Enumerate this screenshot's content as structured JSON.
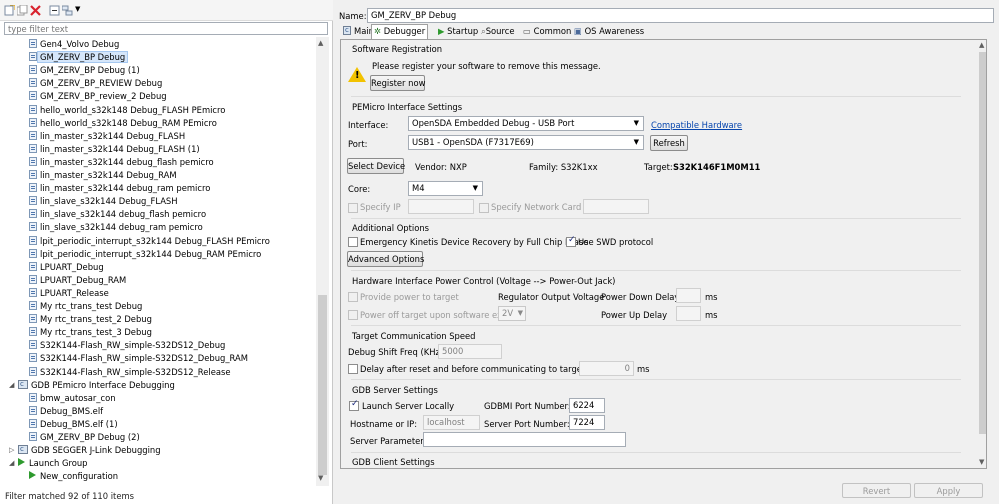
{
  "filter": {
    "placeholder": "type filter text"
  },
  "tree": {
    "items": [
      "Gen4_Volvo Debug",
      "GM_ZERV_BP Debug",
      "GM_ZERV_BP Debug (1)",
      "GM_ZERV_BP_REVIEW Debug",
      "GM_ZERV_BP_review_2 Debug",
      "hello_world_s32k148 Debug_FLASH PEmicro",
      "hello_world_s32k148 Debug_RAM PEmicro",
      "lin_master_s32k144 Debug_FLASH",
      "lin_master_s32k144 Debug_FLASH (1)",
      "lin_master_s32k144 debug_flash pemicro",
      "lin_master_s32k144 Debug_RAM",
      "lin_master_s32k144 debug_ram pemicro",
      "lin_slave_s32k144 Debug_FLASH",
      "lin_slave_s32k144 debug_flash pemicro",
      "lin_slave_s32k144 debug_ram pemicro",
      "lpit_periodic_interrupt_s32k144 Debug_FLASH PEmicro",
      "lpit_periodic_interrupt_s32k144 Debug_RAM PEmicro",
      "LPUART_Debug",
      "LPUART_Debug_RAM",
      "LPUART_Release",
      "My rtc_trans_test Debug",
      "My rtc_trans_test_2 Debug",
      "My rtc_trans_test_3 Debug",
      "S32K144-Flash_RW_simple-S32DS12_Debug",
      "S32K144-Flash_RW_simple-S32DS12_Debug_RAM",
      "S32K144-Flash_RW_simple-S32DS12_Release"
    ],
    "pemicro_group": "GDB PEmicro Interface Debugging",
    "pemicro_items": [
      "bmw_autosar_con",
      "Debug_BMS.elf",
      "Debug_BMS.elf (1)",
      "GM_ZERV_BP Debug (2)"
    ],
    "segger_group": "GDB SEGGER J-Link Debugging",
    "launch_group": "Launch Group",
    "launch_items": [
      "New_configuration"
    ]
  },
  "status": "Filter matched 92 of 110 items",
  "name": {
    "label": "Name:",
    "value": "GM_ZERV_BP Debug"
  },
  "tabs": [
    "Main",
    "Debugger",
    "Startup",
    "Source",
    "Common",
    "OS Awareness"
  ],
  "software_registration": {
    "title": "Software Registration",
    "message": "Please register your software to remove this message.",
    "button": "Register now"
  },
  "pemicro": {
    "title": "PEMicro Interface Settings",
    "interface_label": "Interface:",
    "interface_value": "OpenSDA Embedded Debug - USB Port",
    "compatible_link": "Compatible Hardware",
    "port_label": "Port:",
    "port_value": "USB1 - OpenSDA (F7317E69)",
    "refresh": "Refresh",
    "select_device": "Select Device",
    "vendor": "Vendor: NXP",
    "family": "Family: S32K1xx",
    "target_label": "Target:",
    "target_value": "S32K146F1M0M11",
    "core_label": "Core:",
    "core_value": "M4",
    "specify_ip": "Specify IP",
    "specify_nc_ip": "Specify Network Card IP"
  },
  "additional": {
    "title": "Additional Options",
    "emergency": "Emergency Kinetis Device Recovery by Full Chip Erase",
    "swd": "Use SWD protocol",
    "advanced": "Advanced Options"
  },
  "power": {
    "title": "Hardware Interface Power Control (Voltage --> Power-Out Jack)",
    "provide": "Provide power to target",
    "regulator": "Regulator Output Voltage",
    "power_down": "Power Down Delay",
    "ms1": "ms",
    "power_off": "Power off target upon software exit",
    "voltage": "2V",
    "power_up": "Power Up Delay",
    "ms2": "ms"
  },
  "comm": {
    "title": "Target Communication Speed",
    "shift_label": "Debug Shift Freq (KHz)",
    "shift_value": "5000",
    "delay_label": "Delay after reset and before communicating to target for",
    "delay_value": "0",
    "ms": "ms"
  },
  "gdb_server": {
    "title": "GDB Server Settings",
    "launch_local": "Launch Server Locally",
    "gdbmi_label": "GDBMI Port Number:",
    "gdbmi_value": "6224",
    "host_label": "Hostname or IP:",
    "host_value": "localhost",
    "server_port_label": "Server Port Number:",
    "server_port_value": "7224",
    "params_label": "Server Parameters:",
    "params_value": ""
  },
  "gdb_client": {
    "title": "GDB Client Settings"
  },
  "footer": {
    "revert": "Revert",
    "apply": "Apply"
  }
}
